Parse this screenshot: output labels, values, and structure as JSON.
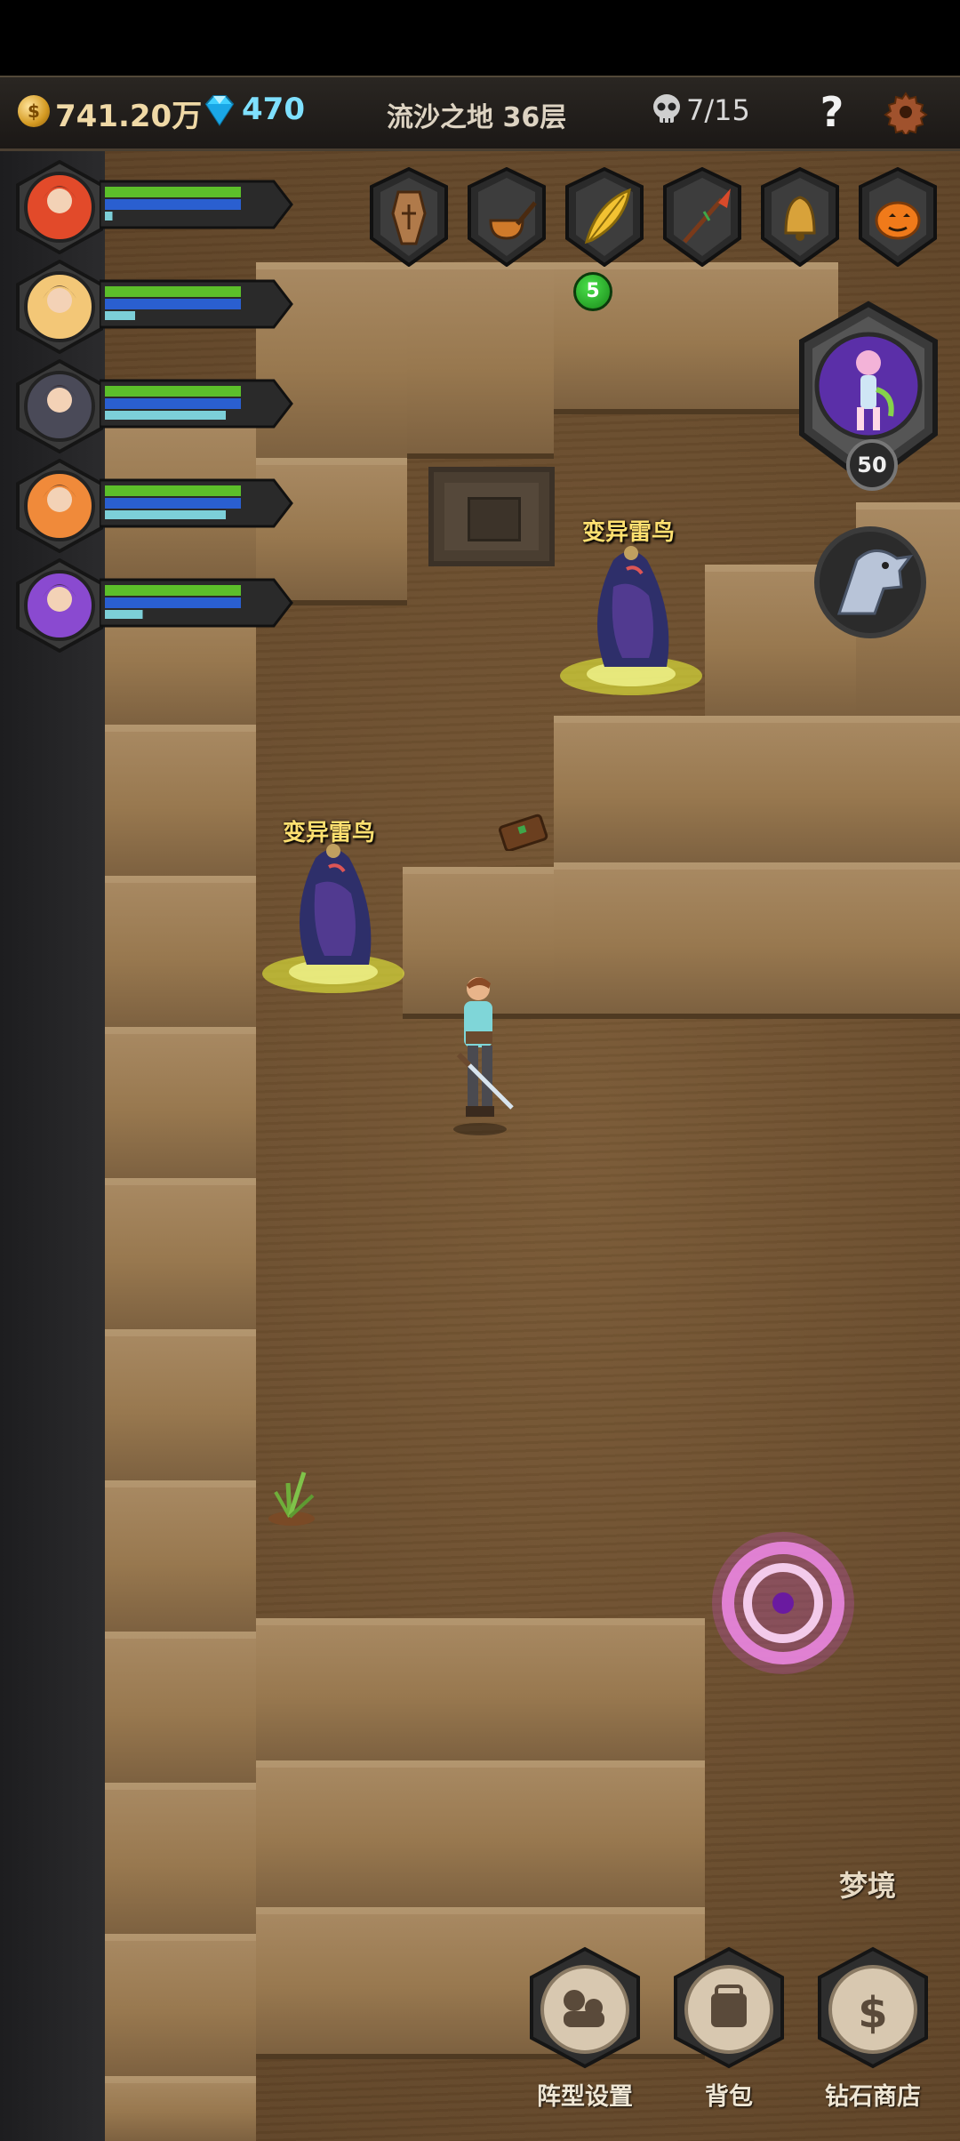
{
  "topbar": {
    "gold": "741.20万",
    "gems": "470",
    "floor": "流沙之地 36层",
    "kills": "7/15",
    "help": "?"
  },
  "party": [
    {
      "name": "member-1",
      "hp": 0.9,
      "mp": 0.9,
      "exp": 0.05,
      "theme": "#e24a2a"
    },
    {
      "name": "member-2",
      "hp": 0.9,
      "mp": 0.9,
      "exp": 0.2,
      "theme": "#f3c777"
    },
    {
      "name": "member-3",
      "hp": 0.9,
      "mp": 0.9,
      "exp": 0.8,
      "theme": "#4a4a58"
    },
    {
      "name": "member-4",
      "hp": 0.9,
      "mp": 0.9,
      "exp": 0.8,
      "theme": "#f08a3a"
    },
    {
      "name": "member-5",
      "hp": 0.9,
      "mp": 0.9,
      "exp": 0.25,
      "theme": "#8a4ad0"
    }
  ],
  "items": [
    {
      "icon": "coffin-icon"
    },
    {
      "icon": "pipe-icon"
    },
    {
      "icon": "feather-icon",
      "badge": "5"
    },
    {
      "icon": "spear-icon"
    },
    {
      "icon": "bell-icon"
    },
    {
      "icon": "pumpkin-icon"
    }
  ],
  "boss": {
    "level": "50"
  },
  "enemies": [
    {
      "label": "变异雷鸟"
    },
    {
      "label": "变异雷鸟"
    }
  ],
  "dream_label": "梦境",
  "menu": [
    {
      "label": "阵型设置",
      "icon": "formation-icon"
    },
    {
      "label": "背包",
      "icon": "backpack-icon"
    },
    {
      "label": "钻石商店",
      "icon": "dollar-icon"
    }
  ]
}
